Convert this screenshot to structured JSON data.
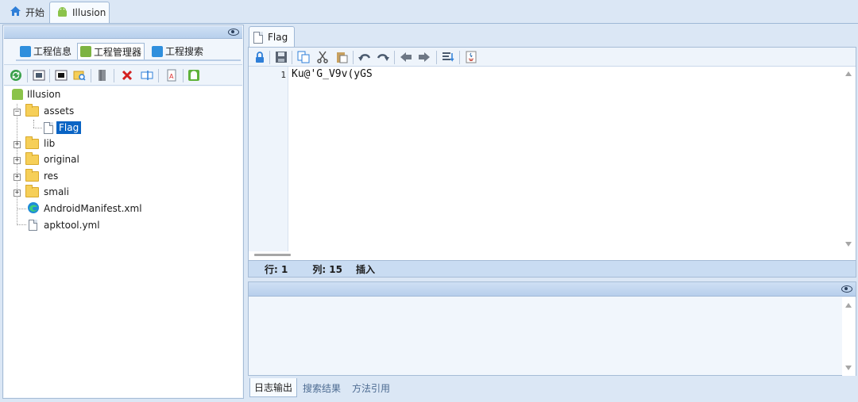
{
  "doc_tabs": [
    {
      "label": "开始",
      "icon": "home-icon"
    },
    {
      "label": "Illusion",
      "icon": "android-icon"
    }
  ],
  "left_panel": {
    "tabs": [
      {
        "label": "工程信息",
        "icon": "info-icon"
      },
      {
        "label": "工程管理器",
        "icon": "android-icon"
      },
      {
        "label": "工程搜索",
        "icon": "search-icon"
      }
    ],
    "toolbar_icons": [
      "refresh-icon",
      "export-icon",
      "window-icon",
      "find-file-icon",
      "book-icon",
      "delete-icon",
      "rename-icon",
      "text-file-icon",
      "android-build-icon"
    ],
    "tree": {
      "root": "Illusion",
      "items": [
        {
          "label": "assets",
          "type": "folder",
          "expanded": true
        },
        {
          "label": "Flag",
          "type": "file",
          "selected": true
        },
        {
          "label": "lib",
          "type": "folder"
        },
        {
          "label": "original",
          "type": "folder"
        },
        {
          "label": "res",
          "type": "folder"
        },
        {
          "label": "smali",
          "type": "folder"
        },
        {
          "label": "AndroidManifest.xml",
          "type": "xml"
        },
        {
          "label": "apktool.yml",
          "type": "yml"
        }
      ]
    }
  },
  "editor": {
    "tab_label": "Flag",
    "line_number": "1",
    "code": "Ku@'G_V9v(yGS",
    "status": {
      "row": "行: 1",
      "col": "列: 15",
      "mode": "插入"
    }
  },
  "log_panel": {
    "tabs": [
      "日志输出",
      "搜索结果",
      "方法引用"
    ]
  },
  "colors": {
    "accent": "#0a64c4",
    "panel": "#dbe7f5"
  }
}
